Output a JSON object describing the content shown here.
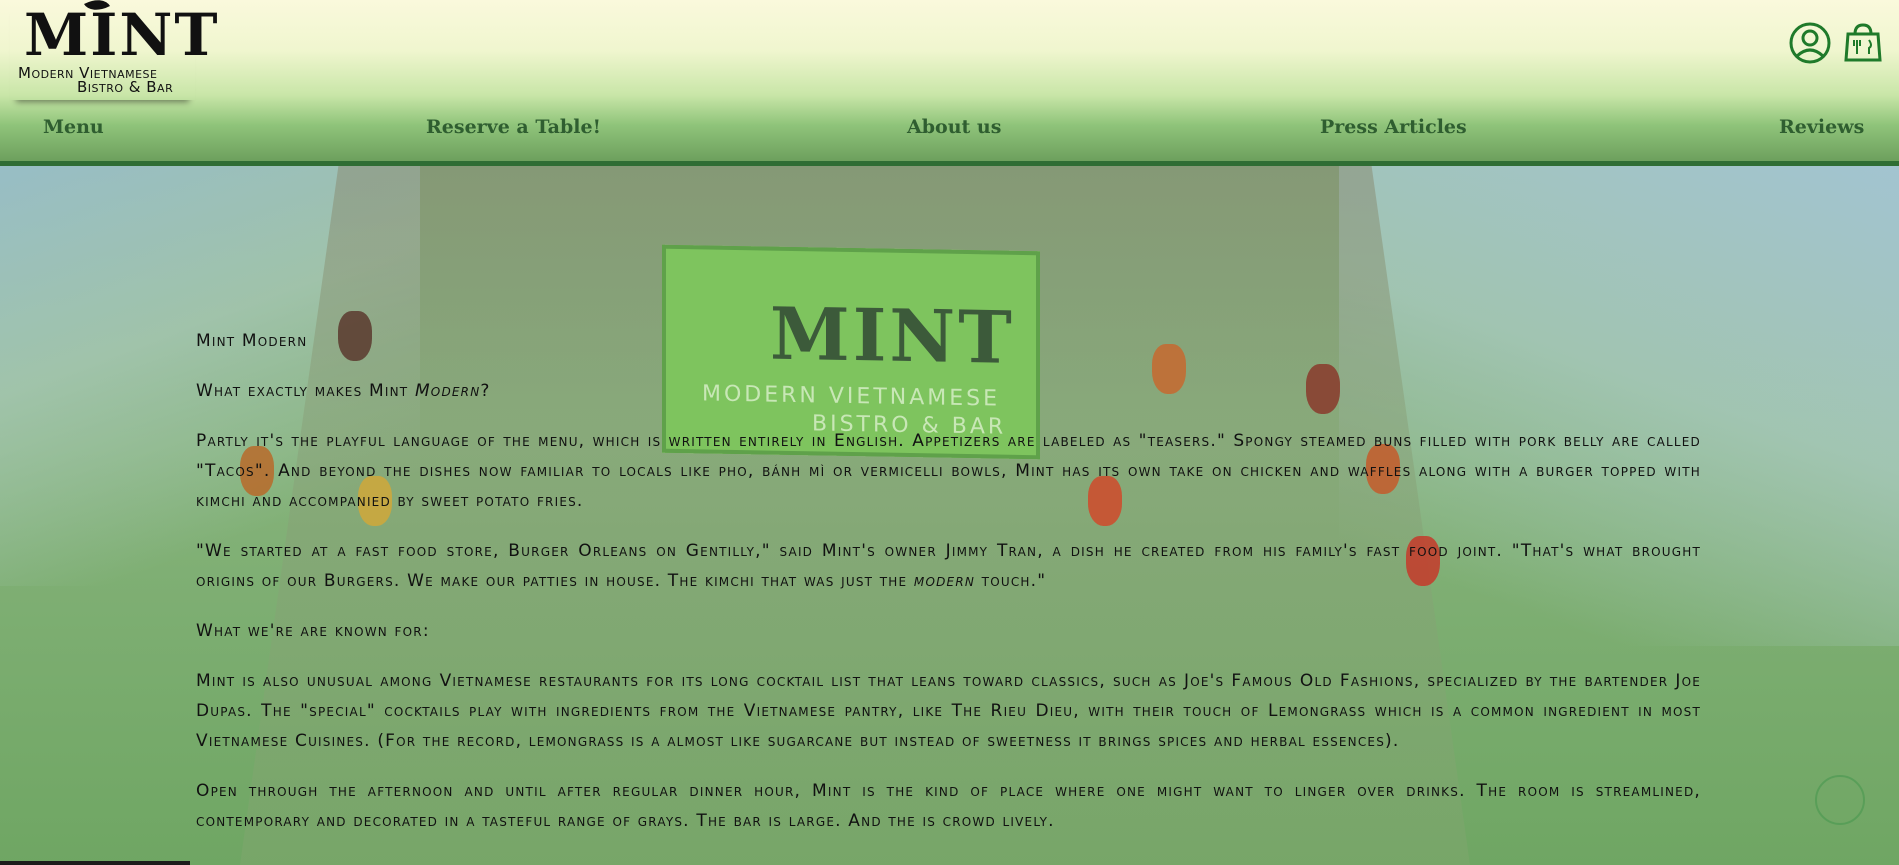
{
  "brand": {
    "logo_word": "MINT",
    "logo_line1": "Modern Vietnamese",
    "logo_line2": "Bistro & Bar"
  },
  "header": {
    "account_icon": "user-circle-icon",
    "cart_icon": "shopping-bag-icon",
    "nav": [
      {
        "label": "Menu"
      },
      {
        "label": "Reserve a Table!"
      },
      {
        "label": "About us"
      },
      {
        "label": "Press Articles"
      },
      {
        "label": "Reviews"
      }
    ]
  },
  "hero_sign": {
    "word": "MINT",
    "line1": "MODERN VIETNAMESE",
    "line2": "BISTRO & BAR"
  },
  "content": {
    "title": "Mint Modern",
    "q_prefix": "What exactly makes Mint ",
    "q_em": "Modern",
    "q_suffix": "?",
    "p1": "Partly it's the playful language of the menu, which is written entirely in English. Appetizers are labeled as \"teasers.\" Spongy steamed buns filled with pork belly are called \"Tacos\". And beyond the dishes now familiar to locals like pho, bánh mì or vermicelli bowls, Mint has its own take on chicken and waffles along with a burger topped with kimchi and accompanied by sweet potato fries.",
    "p2_prefix": "\"We started at a fast food store, Burger Orleans on Gentilly,\" said Mint's owner Jimmy Tran, a dish he created from his family's fast food joint. \"That's what brought origins of our Burgers. We make our patties in house. The kimchi that was just the ",
    "p2_em": "modern",
    "p2_suffix": " touch.\"",
    "known_heading": "What we're are known for:",
    "p3": "Mint is also unusual among Vietnamese restaurants for its long cocktail list that leans toward classics, such as Joe's Famous Old Fashions, specialized by the bartender Joe Dupas. The \"special\" cocktails play with ingredients from the Vietnamese pantry, like The Rieu Dieu, with their touch of Lemongrass which is a common ingredient in most Vietnamese Cuisines. (For the record, lemongrass is a almost like sugarcane but instead of sweetness it brings spices and herbal essences).",
    "p4": "Open through the afternoon and until after regular dinner hour, Mint is the kind of place where one might want to linger over drinks. The room is streamlined, contemporary and decorated in a tasteful range of grays. The bar is large. And the is crowd lively."
  },
  "colors": {
    "header_top": "#faf9dc",
    "header_bottom": "#6ea15e",
    "nav_text": "#2f5e30",
    "icon_green": "#1f7a2a",
    "overlay_green": "#7fae6a"
  }
}
